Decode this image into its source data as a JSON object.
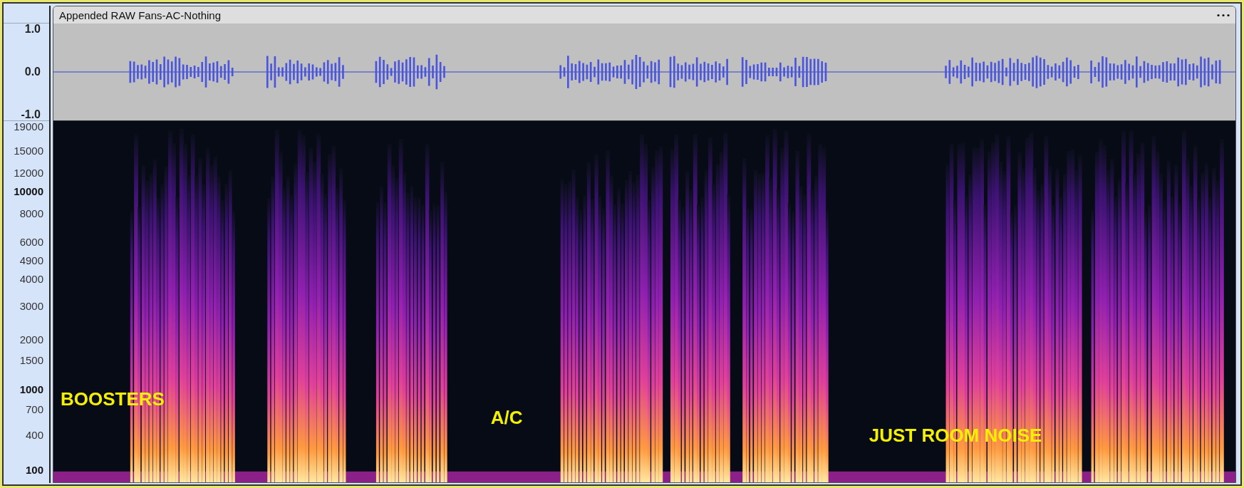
{
  "clip": {
    "title": "Appended RAW Fans-AC-Nothing"
  },
  "waveform_scale": [
    {
      "label": "1.0"
    },
    {
      "label": "0.0"
    },
    {
      "label": "-1.0"
    }
  ],
  "spectrogram_scale": [
    {
      "label": "19000",
      "major": false
    },
    {
      "label": "15000",
      "major": false
    },
    {
      "label": "12000",
      "major": false
    },
    {
      "label": "10000",
      "major": true
    },
    {
      "label": "8000",
      "major": false
    },
    {
      "label": "6000",
      "major": false
    },
    {
      "label": "4900",
      "major": false
    },
    {
      "label": "4000",
      "major": false
    },
    {
      "label": "3000",
      "major": false
    },
    {
      "label": "2000",
      "major": false
    },
    {
      "label": "1500",
      "major": false
    },
    {
      "label": "1000",
      "major": true
    },
    {
      "label": "700",
      "major": false
    },
    {
      "label": "400",
      "major": false
    },
    {
      "label": "100",
      "major": true
    }
  ],
  "annotations": [
    {
      "text": "BOOSTERS"
    },
    {
      "text": "A/C"
    },
    {
      "text": "JUST ROOM NOISE"
    }
  ]
}
